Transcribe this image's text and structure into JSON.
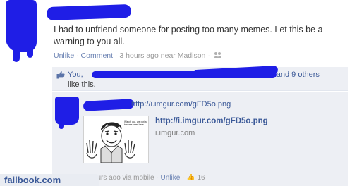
{
  "post": {
    "text": "I had to unfriend someone for posting too many memes. Let this be a warning to you all.",
    "unlike_label": "Unlike",
    "comment_label": "Comment",
    "timestamp": "3 hours ago near Madison",
    "separator": "·"
  },
  "likes": {
    "you_label": "You,",
    "others_label": "and 9 others",
    "suffix": "like this."
  },
  "comment": {
    "url_text": "http://i.imgur.com/gFD5o.png",
    "attachment_title": "http://i.imgur.com/gFD5o.png",
    "attachment_domain": "i.imgur.com",
    "meme_caption": "Watch out, we got a badass over here.",
    "time_text": "3 hours ago via mobile",
    "unlike_label": "Unlike",
    "like_count": "16"
  },
  "watermark": {
    "text": "failbook.com"
  },
  "colors": {
    "link": "#3b5998",
    "redaction": "#1f1ee6",
    "comment_bg": "#edeff4"
  }
}
